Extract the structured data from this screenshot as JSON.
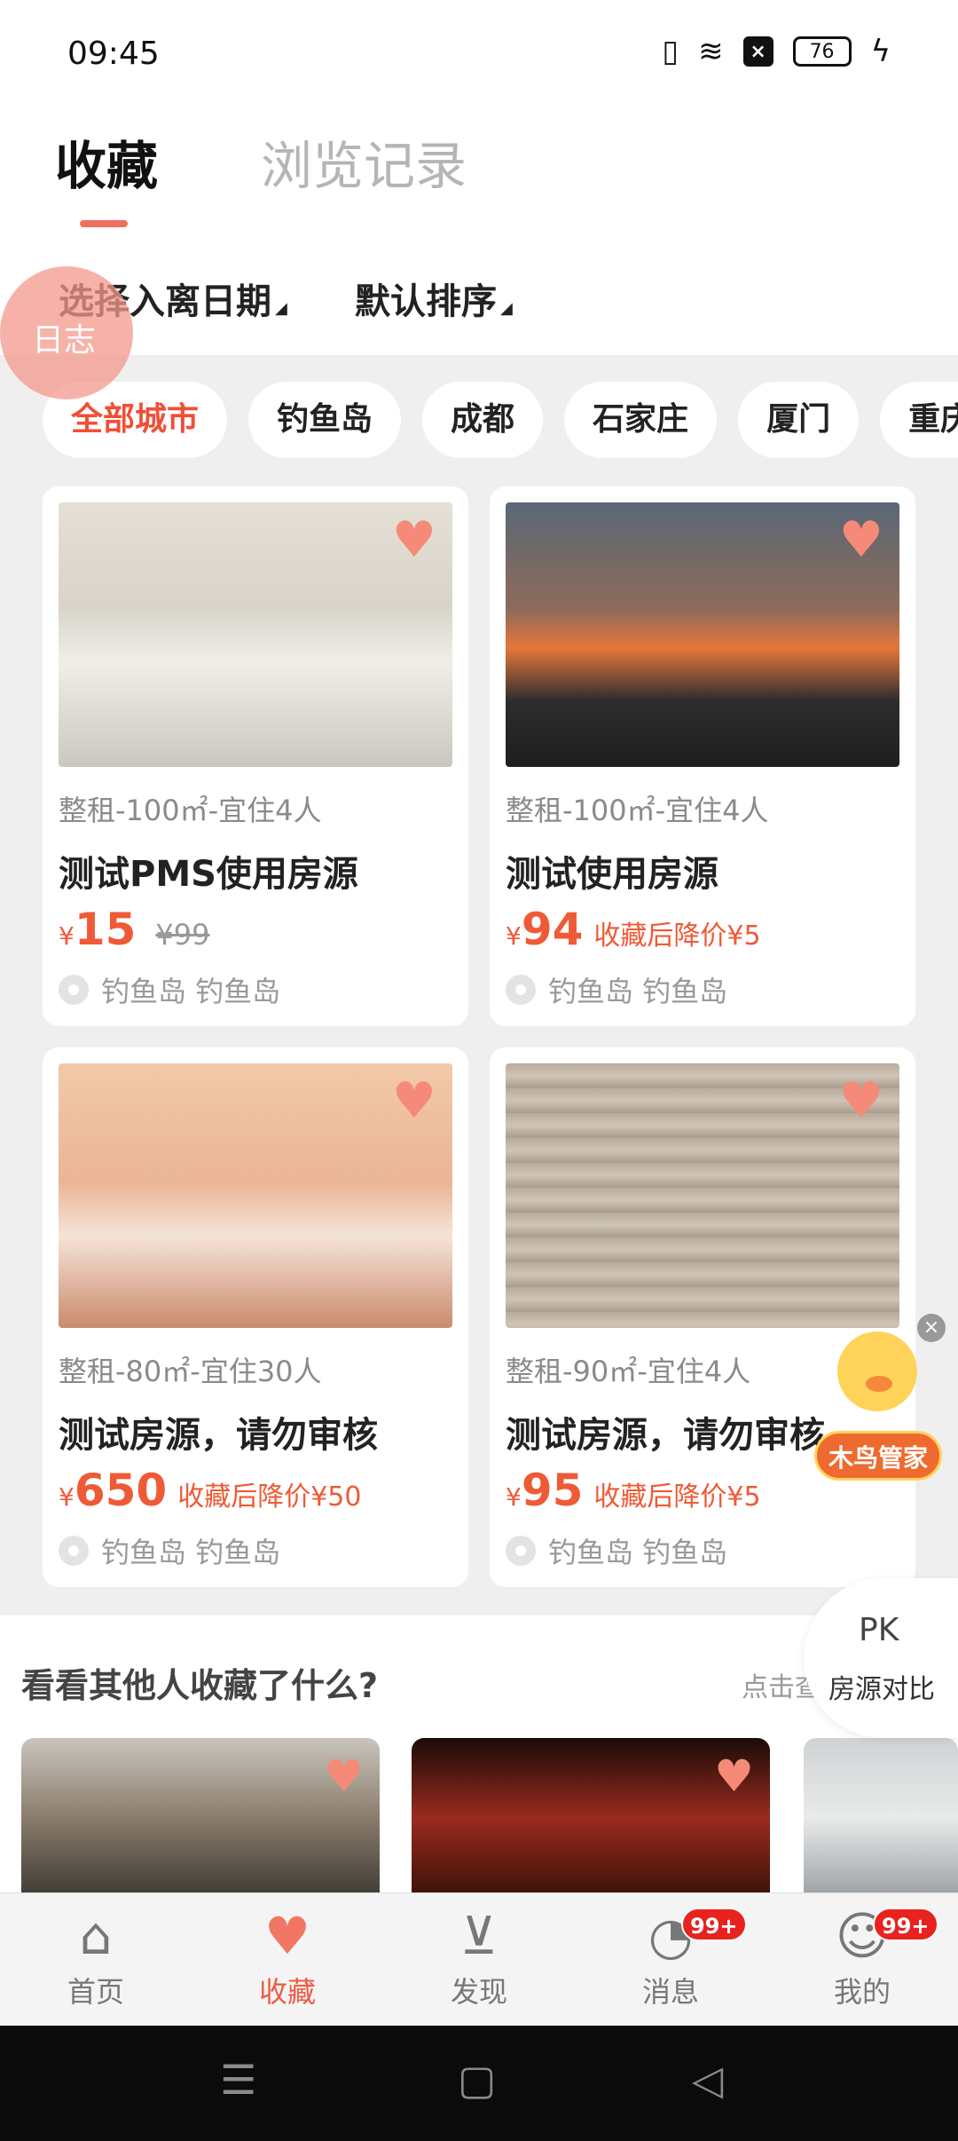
{
  "status_bar": {
    "time": "09:45",
    "battery": "76"
  },
  "tabs": [
    {
      "label": "收藏",
      "active": true
    },
    {
      "label": "浏览记录",
      "active": false
    }
  ],
  "filters": {
    "date": "选择入离日期",
    "sort": "默认排序"
  },
  "floating_log": "日志",
  "city_chips": [
    {
      "label": "全部城市",
      "active": true
    },
    {
      "label": "钓鱼岛"
    },
    {
      "label": "成都"
    },
    {
      "label": "石家庄"
    },
    {
      "label": "厦门"
    },
    {
      "label": "重庆"
    }
  ],
  "listings": [
    {
      "meta": "整租-100㎡-宜住4人",
      "title": "测试PMS使用房源",
      "yen": "¥",
      "price": "15",
      "drop_text": "",
      "original_price": "¥99",
      "location": "钓鱼岛 钓鱼岛"
    },
    {
      "meta": "整租-100㎡-宜住4人",
      "title": "测试使用房源",
      "yen": "¥",
      "price": "94",
      "drop_text": "收藏后降价¥5",
      "original_price": "",
      "location": "钓鱼岛 钓鱼岛"
    },
    {
      "meta": "整租-80㎡-宜住30人",
      "title": "测试房源，请勿审核",
      "yen": "¥",
      "price": "650",
      "drop_text": "收藏后降价¥50",
      "original_price": "",
      "location": "钓鱼岛 钓鱼岛"
    },
    {
      "meta": "整租-90㎡-宜住4人",
      "title": "测试房源，请勿审核",
      "yen": "¥",
      "price": "95",
      "drop_text": "收藏后降价¥5",
      "original_price": "",
      "location": "钓鱼岛 钓鱼岛"
    }
  ],
  "mascot_label": "木鸟管家",
  "compare": {
    "badge": "PK",
    "label": "房源对比"
  },
  "suggestions": {
    "title": "看看其他人收藏了什么?",
    "hint": "点击查看"
  },
  "bottom_nav": [
    {
      "label": "首页",
      "icon": "home-icon",
      "badge": ""
    },
    {
      "label": "收藏",
      "icon": "heart-icon",
      "badge": "",
      "active": true
    },
    {
      "label": "发现",
      "icon": "discover-icon",
      "badge": ""
    },
    {
      "label": "消息",
      "icon": "message-icon",
      "badge": "99+"
    },
    {
      "label": "我的",
      "icon": "profile-icon",
      "badge": "99+"
    }
  ],
  "colors": {
    "accent": "#ef5a43",
    "price": "#ef5a36",
    "heart": "#f58a78",
    "background": "#efefef"
  }
}
